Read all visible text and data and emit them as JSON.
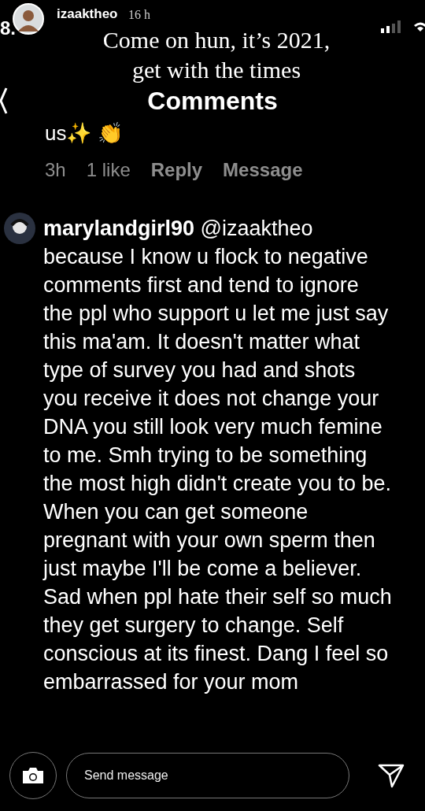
{
  "status_bar": {
    "time": "8."
  },
  "story": {
    "username": "izaaktheo",
    "time": "16 h",
    "caption": "Come on hun, it’s 2021, get with the times"
  },
  "header": {
    "title": "Comments"
  },
  "previous_comment": {
    "text": "us✨ 👏",
    "meta": [
      "3h",
      "1 like",
      "Reply",
      "Message"
    ]
  },
  "comment": {
    "text": "**marylandgirl90** @izaaktheo because I know u flock to negative comments first and tend to ignore the ppl who support u let me just say this ma'am. It doesn't matter what type of survey you had and shots you receive it does not change your DNA you still look very much femine to me. Smh trying to be something the most high didn't create you to be. When you can get someone pregnant with your own sperm then just maybe I'll be come a believer. Sad when ppl hate their self so much they get surgery to change. Self conscious at its finest. Dang I feel so embarrassed for your mom"
  },
  "reply_bar": {
    "placeholder": "Send message"
  }
}
